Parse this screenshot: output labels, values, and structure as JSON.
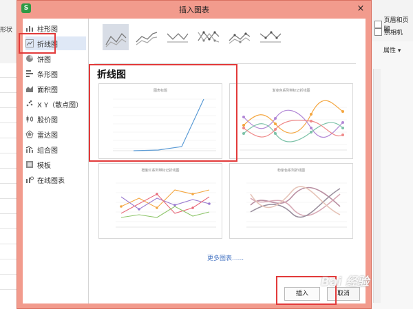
{
  "background": {
    "left_toolbar_label": "形状",
    "right_tools": [
      {
        "icon": "header-footer-icon",
        "label": "页眉和页脚"
      },
      {
        "icon": "camera-icon",
        "label": "照相机"
      }
    ],
    "properties_label": "属性"
  },
  "dialog": {
    "app_logo": "S",
    "title": "插入图表",
    "close_symbol": "×",
    "categories": [
      {
        "icon": "bar-chart-icon",
        "label": "柱形图"
      },
      {
        "icon": "line-chart-icon",
        "label": "折线图"
      },
      {
        "icon": "pie-chart-icon",
        "label": "饼图"
      },
      {
        "icon": "horizontal-bar-chart-icon",
        "label": "条形图"
      },
      {
        "icon": "area-chart-icon",
        "label": "面积图"
      },
      {
        "icon": "scatter-chart-icon",
        "label": "X Y（散点图）"
      },
      {
        "icon": "stock-chart-icon",
        "label": "股价图"
      },
      {
        "icon": "radar-chart-icon",
        "label": "雷达图"
      },
      {
        "icon": "combo-chart-icon",
        "label": "组合图"
      },
      {
        "icon": "template-icon",
        "label": "模板"
      },
      {
        "icon": "online-chart-icon",
        "label": "在线图表"
      }
    ],
    "active_category": 1,
    "section_title": "折线图",
    "thumbnails": [
      {
        "title": "图表标题"
      },
      {
        "title": "渐变色系列带标记折线图"
      },
      {
        "title": "橙紫红系列带标记折线图"
      },
      {
        "title": "粉紫色系列折线图"
      }
    ],
    "more_charts": "更多图表......",
    "insert_label": "插入",
    "cancel_label": "取消"
  },
  "watermark": "Bai 经验",
  "colors": {
    "dialog_frame": "#f29b8d",
    "highlight_red": "#e23a3a",
    "accent_blue": "#5b9bd5",
    "link_blue": "#4b78c4"
  }
}
